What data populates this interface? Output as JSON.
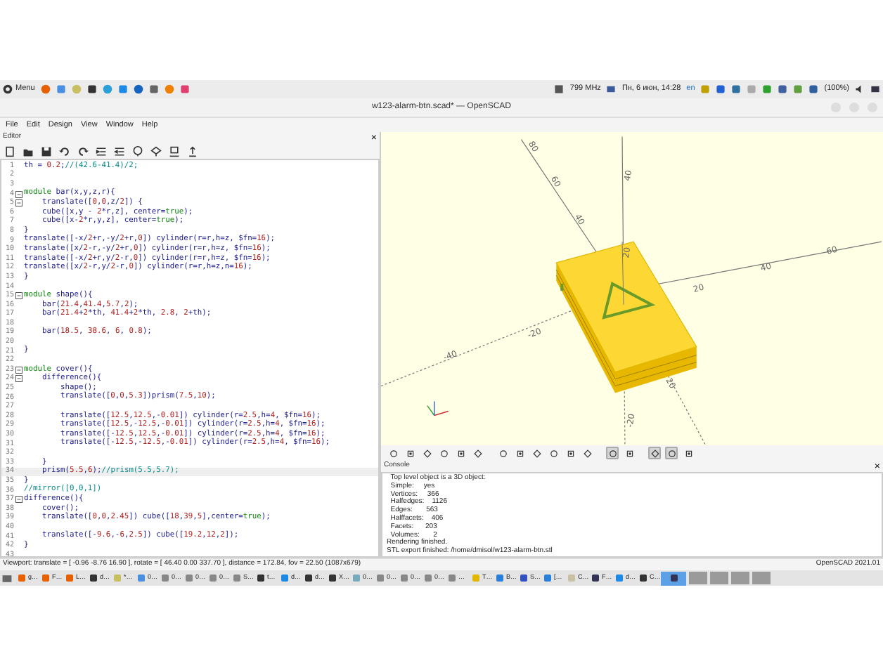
{
  "top_panel": {
    "menu_label": "Menu",
    "cpu": "799 MHz",
    "clock": "Пн, 6 июн, 14:28",
    "keyboard": "en",
    "battery": "(100%)"
  },
  "window": {
    "title": "w123-alarm-btn.scad* — OpenSCAD"
  },
  "menu": [
    "File",
    "Edit",
    "Design",
    "View",
    "Window",
    "Help"
  ],
  "editor": {
    "title": "Editor",
    "close": "×",
    "lines": [
      {
        "number": "1",
        "fold": false,
        "current": false,
        "tokens": [
          {
            "kind": "plain",
            "text": "th = "
          },
          {
            "kind": "number",
            "text": "0.2"
          },
          {
            "kind": "plain",
            "text": ";"
          },
          {
            "kind": "comment",
            "text": "//(42.6-41.4)/2;"
          }
        ]
      },
      {
        "number": "2",
        "fold": false,
        "current": false
      },
      {
        "number": "3",
        "fold": false,
        "current": false
      },
      {
        "number": "4",
        "fold": true,
        "current": false,
        "tokens": [
          {
            "kind": "keyword",
            "text": "module"
          },
          {
            "kind": "plain",
            "text": " bar(x,y,z,r){"
          }
        ]
      },
      {
        "number": "5",
        "fold": true,
        "current": false,
        "tokens": [
          {
            "kind": "plain",
            "text": "    translate(["
          },
          {
            "kind": "number",
            "text": "0"
          },
          {
            "kind": "plain",
            "text": ","
          },
          {
            "kind": "number",
            "text": "0"
          },
          {
            "kind": "plain",
            "text": ",z/"
          },
          {
            "kind": "number",
            "text": "2"
          },
          {
            "kind": "plain",
            "text": "]) {"
          }
        ]
      },
      {
        "number": "6",
        "fold": false,
        "current": false,
        "tokens": [
          {
            "kind": "plain",
            "text": "    cube([x,y - "
          },
          {
            "kind": "number",
            "text": "2"
          },
          {
            "kind": "plain",
            "text": "*r,z], center="
          },
          {
            "kind": "keyword",
            "text": "true"
          },
          {
            "kind": "plain",
            "text": ");"
          }
        ]
      },
      {
        "number": "7",
        "fold": false,
        "current": false,
        "tokens": [
          {
            "kind": "plain",
            "text": "    cube([x-"
          },
          {
            "kind": "number",
            "text": "2"
          },
          {
            "kind": "plain",
            "text": "*r,y,z], center="
          },
          {
            "kind": "keyword",
            "text": "true"
          },
          {
            "kind": "plain",
            "text": ");"
          }
        ]
      },
      {
        "number": "8",
        "fold": false,
        "current": false,
        "tokens": [
          {
            "kind": "plain",
            "text": "}"
          }
        ]
      },
      {
        "number": "9",
        "fold": false,
        "current": false,
        "tokens": [
          {
            "kind": "plain",
            "text": "translate([-x/"
          },
          {
            "kind": "number",
            "text": "2"
          },
          {
            "kind": "plain",
            "text": "+r,-y/"
          },
          {
            "kind": "number",
            "text": "2"
          },
          {
            "kind": "plain",
            "text": "+r,"
          },
          {
            "kind": "number",
            "text": "0"
          },
          {
            "kind": "plain",
            "text": "]) cylinder(r=r,h=z, $fn="
          },
          {
            "kind": "number",
            "text": "16"
          },
          {
            "kind": "plain",
            "text": ");"
          }
        ]
      },
      {
        "number": "10",
        "fold": false,
        "current": false,
        "tokens": [
          {
            "kind": "plain",
            "text": "translate([x/"
          },
          {
            "kind": "number",
            "text": "2"
          },
          {
            "kind": "plain",
            "text": "-r,-y/"
          },
          {
            "kind": "number",
            "text": "2"
          },
          {
            "kind": "plain",
            "text": "+r,"
          },
          {
            "kind": "number",
            "text": "0"
          },
          {
            "kind": "plain",
            "text": "]) cylinder(r=r,h=z, $fn="
          },
          {
            "kind": "number",
            "text": "16"
          },
          {
            "kind": "plain",
            "text": ");"
          }
        ]
      },
      {
        "number": "11",
        "fold": false,
        "current": false,
        "tokens": [
          {
            "kind": "plain",
            "text": "translate([-x/"
          },
          {
            "kind": "number",
            "text": "2"
          },
          {
            "kind": "plain",
            "text": "+r,y/"
          },
          {
            "kind": "number",
            "text": "2"
          },
          {
            "kind": "plain",
            "text": "-r,"
          },
          {
            "kind": "number",
            "text": "0"
          },
          {
            "kind": "plain",
            "text": "]) cylinder(r=r,h=z, $fn="
          },
          {
            "kind": "number",
            "text": "16"
          },
          {
            "kind": "plain",
            "text": ");"
          }
        ]
      },
      {
        "number": "12",
        "fold": false,
        "current": false,
        "tokens": [
          {
            "kind": "plain",
            "text": "translate([x/"
          },
          {
            "kind": "number",
            "text": "2"
          },
          {
            "kind": "plain",
            "text": "-r,y/"
          },
          {
            "kind": "number",
            "text": "2"
          },
          {
            "kind": "plain",
            "text": "-r,"
          },
          {
            "kind": "number",
            "text": "0"
          },
          {
            "kind": "plain",
            "text": "]) cylinder(r=r,h=z,n="
          },
          {
            "kind": "number",
            "text": "16"
          },
          {
            "kind": "plain",
            "text": ");"
          }
        ]
      },
      {
        "number": "13",
        "fold": false,
        "current": false,
        "tokens": [
          {
            "kind": "plain",
            "text": "}"
          }
        ]
      },
      {
        "number": "14",
        "fold": false,
        "current": false
      },
      {
        "number": "15",
        "fold": true,
        "current": false,
        "tokens": [
          {
            "kind": "keyword",
            "text": "module"
          },
          {
            "kind": "plain",
            "text": " shape(){"
          }
        ]
      },
      {
        "number": "16",
        "fold": false,
        "current": false,
        "tokens": [
          {
            "kind": "plain",
            "text": "    bar("
          },
          {
            "kind": "number",
            "text": "21.4"
          },
          {
            "kind": "plain",
            "text": ","
          },
          {
            "kind": "number",
            "text": "41.4"
          },
          {
            "kind": "plain",
            "text": ","
          },
          {
            "kind": "number",
            "text": "5.7"
          },
          {
            "kind": "plain",
            "text": ","
          },
          {
            "kind": "number",
            "text": "2"
          },
          {
            "kind": "plain",
            "text": ");"
          }
        ]
      },
      {
        "number": "17",
        "fold": false,
        "current": false,
        "tokens": [
          {
            "kind": "plain",
            "text": "    bar("
          },
          {
            "kind": "number",
            "text": "21.4"
          },
          {
            "kind": "plain",
            "text": "+"
          },
          {
            "kind": "number",
            "text": "2"
          },
          {
            "kind": "plain",
            "text": "*th, "
          },
          {
            "kind": "number",
            "text": "41.4"
          },
          {
            "kind": "plain",
            "text": "+"
          },
          {
            "kind": "number",
            "text": "2"
          },
          {
            "kind": "plain",
            "text": "*th, "
          },
          {
            "kind": "number",
            "text": "2.8"
          },
          {
            "kind": "plain",
            "text": ", "
          },
          {
            "kind": "number",
            "text": "2"
          },
          {
            "kind": "plain",
            "text": "+th);"
          }
        ]
      },
      {
        "number": "18",
        "fold": false,
        "current": false
      },
      {
        "number": "19",
        "fold": false,
        "current": false,
        "tokens": [
          {
            "kind": "plain",
            "text": "    bar("
          },
          {
            "kind": "number",
            "text": "18.5"
          },
          {
            "kind": "plain",
            "text": ", "
          },
          {
            "kind": "number",
            "text": "38.6"
          },
          {
            "kind": "plain",
            "text": ", "
          },
          {
            "kind": "number",
            "text": "6"
          },
          {
            "kind": "plain",
            "text": ", "
          },
          {
            "kind": "number",
            "text": "0.8"
          },
          {
            "kind": "plain",
            "text": ");"
          }
        ]
      },
      {
        "number": "20",
        "fold": false,
        "current": false
      },
      {
        "number": "21",
        "fold": false,
        "current": false,
        "tokens": [
          {
            "kind": "plain",
            "text": "}"
          }
        ]
      },
      {
        "number": "22",
        "fold": false,
        "current": false
      },
      {
        "number": "23",
        "fold": true,
        "current": false,
        "tokens": [
          {
            "kind": "keyword",
            "text": "module"
          },
          {
            "kind": "plain",
            "text": " cover(){"
          }
        ]
      },
      {
        "number": "24",
        "fold": true,
        "current": false,
        "tokens": [
          {
            "kind": "plain",
            "text": "    difference(){"
          }
        ]
      },
      {
        "number": "25",
        "fold": false,
        "current": false,
        "tokens": [
          {
            "kind": "plain",
            "text": "        shape();"
          }
        ]
      },
      {
        "number": "26",
        "fold": false,
        "current": false,
        "tokens": [
          {
            "kind": "plain",
            "text": "        translate(["
          },
          {
            "kind": "number",
            "text": "0"
          },
          {
            "kind": "plain",
            "text": ","
          },
          {
            "kind": "number",
            "text": "0"
          },
          {
            "kind": "plain",
            "text": ","
          },
          {
            "kind": "number",
            "text": "5.3"
          },
          {
            "kind": "plain",
            "text": "])prism("
          },
          {
            "kind": "number",
            "text": "7.5"
          },
          {
            "kind": "plain",
            "text": ","
          },
          {
            "kind": "number",
            "text": "10"
          },
          {
            "kind": "plain",
            "text": ");"
          }
        ]
      },
      {
        "number": "27",
        "fold": false,
        "current": false
      },
      {
        "number": "28",
        "fold": false,
        "current": false,
        "tokens": [
          {
            "kind": "plain",
            "text": "        translate(["
          },
          {
            "kind": "number",
            "text": "12.5"
          },
          {
            "kind": "plain",
            "text": ","
          },
          {
            "kind": "number",
            "text": "12.5"
          },
          {
            "kind": "plain",
            "text": ",-"
          },
          {
            "kind": "number",
            "text": "0.01"
          },
          {
            "kind": "plain",
            "text": "]) cylinder(r="
          },
          {
            "kind": "number",
            "text": "2.5"
          },
          {
            "kind": "plain",
            "text": ",h="
          },
          {
            "kind": "number",
            "text": "4"
          },
          {
            "kind": "plain",
            "text": ", $fn="
          },
          {
            "kind": "number",
            "text": "16"
          },
          {
            "kind": "plain",
            "text": ");"
          }
        ]
      },
      {
        "number": "29",
        "fold": false,
        "current": false,
        "tokens": [
          {
            "kind": "plain",
            "text": "        translate(["
          },
          {
            "kind": "number",
            "text": "12.5"
          },
          {
            "kind": "plain",
            "text": ",-"
          },
          {
            "kind": "number",
            "text": "12.5"
          },
          {
            "kind": "plain",
            "text": ",-"
          },
          {
            "kind": "number",
            "text": "0.01"
          },
          {
            "kind": "plain",
            "text": "]) cylinder(r="
          },
          {
            "kind": "number",
            "text": "2.5"
          },
          {
            "kind": "plain",
            "text": ",h="
          },
          {
            "kind": "number",
            "text": "4"
          },
          {
            "kind": "plain",
            "text": ", $fn="
          },
          {
            "kind": "number",
            "text": "16"
          },
          {
            "kind": "plain",
            "text": ");"
          }
        ]
      },
      {
        "number": "30",
        "fold": false,
        "current": false,
        "tokens": [
          {
            "kind": "plain",
            "text": "        translate([-"
          },
          {
            "kind": "number",
            "text": "12.5"
          },
          {
            "kind": "plain",
            "text": ","
          },
          {
            "kind": "number",
            "text": "12.5"
          },
          {
            "kind": "plain",
            "text": ",-"
          },
          {
            "kind": "number",
            "text": "0.01"
          },
          {
            "kind": "plain",
            "text": "]) cylinder(r="
          },
          {
            "kind": "number",
            "text": "2.5"
          },
          {
            "kind": "plain",
            "text": ",h="
          },
          {
            "kind": "number",
            "text": "4"
          },
          {
            "kind": "plain",
            "text": ", $fn="
          },
          {
            "kind": "number",
            "text": "16"
          },
          {
            "kind": "plain",
            "text": ");"
          }
        ]
      },
      {
        "number": "31",
        "fold": false,
        "current": false,
        "tokens": [
          {
            "kind": "plain",
            "text": "        translate([-"
          },
          {
            "kind": "number",
            "text": "12.5"
          },
          {
            "kind": "plain",
            "text": ",-"
          },
          {
            "kind": "number",
            "text": "12.5"
          },
          {
            "kind": "plain",
            "text": ",-"
          },
          {
            "kind": "number",
            "text": "0.01"
          },
          {
            "kind": "plain",
            "text": "]) cylinder(r="
          },
          {
            "kind": "number",
            "text": "2.5"
          },
          {
            "kind": "plain",
            "text": ",h="
          },
          {
            "kind": "number",
            "text": "4"
          },
          {
            "kind": "plain",
            "text": ", $fn="
          },
          {
            "kind": "number",
            "text": "16"
          },
          {
            "kind": "plain",
            "text": ");"
          }
        ]
      },
      {
        "number": "32",
        "fold": false,
        "current": false
      },
      {
        "number": "33",
        "fold": false,
        "current": false,
        "tokens": [
          {
            "kind": "plain",
            "text": "    }"
          }
        ]
      },
      {
        "number": "34",
        "fold": false,
        "current": true,
        "tokens": [
          {
            "kind": "plain",
            "text": "    prism("
          },
          {
            "kind": "number",
            "text": "5.5"
          },
          {
            "kind": "plain",
            "text": ","
          },
          {
            "kind": "number",
            "text": "6"
          },
          {
            "kind": "plain",
            "text": ");"
          },
          {
            "kind": "comment",
            "text": "//prism(5.5,5.7);"
          }
        ]
      },
      {
        "number": "35",
        "fold": false,
        "current": false,
        "tokens": [
          {
            "kind": "plain",
            "text": "}"
          }
        ]
      },
      {
        "number": "36",
        "fold": false,
        "current": false,
        "tokens": [
          {
            "kind": "comment",
            "text": "//mirror([0,0,1])"
          }
        ]
      },
      {
        "number": "37",
        "fold": true,
        "current": false,
        "tokens": [
          {
            "kind": "plain",
            "text": "difference(){"
          }
        ]
      },
      {
        "number": "38",
        "fold": false,
        "current": false,
        "tokens": [
          {
            "kind": "plain",
            "text": "    cover();"
          }
        ]
      },
      {
        "number": "39",
        "fold": false,
        "current": false,
        "tokens": [
          {
            "kind": "plain",
            "text": "    translate(["
          },
          {
            "kind": "number",
            "text": "0"
          },
          {
            "kind": "plain",
            "text": ","
          },
          {
            "kind": "number",
            "text": "0"
          },
          {
            "kind": "plain",
            "text": ","
          },
          {
            "kind": "number",
            "text": "2.45"
          },
          {
            "kind": "plain",
            "text": "]) cube(["
          },
          {
            "kind": "number",
            "text": "18"
          },
          {
            "kind": "plain",
            "text": ","
          },
          {
            "kind": "number",
            "text": "39"
          },
          {
            "kind": "plain",
            "text": ","
          },
          {
            "kind": "number",
            "text": "5"
          },
          {
            "kind": "plain",
            "text": "],center="
          },
          {
            "kind": "keyword",
            "text": "true"
          },
          {
            "kind": "plain",
            "text": ");"
          }
        ]
      },
      {
        "number": "40",
        "fold": false,
        "current": false
      },
      {
        "number": "41",
        "fold": false,
        "current": false,
        "tokens": [
          {
            "kind": "plain",
            "text": "    translate([-"
          },
          {
            "kind": "number",
            "text": "9.6"
          },
          {
            "kind": "plain",
            "text": ",-"
          },
          {
            "kind": "number",
            "text": "6"
          },
          {
            "kind": "plain",
            "text": ","
          },
          {
            "kind": "number",
            "text": "2.5"
          },
          {
            "kind": "plain",
            "text": "]) cube(["
          },
          {
            "kind": "number",
            "text": "19.2"
          },
          {
            "kind": "plain",
            "text": ","
          },
          {
            "kind": "number",
            "text": "12"
          },
          {
            "kind": "plain",
            "text": ","
          },
          {
            "kind": "number",
            "text": "2"
          },
          {
            "kind": "plain",
            "text": "]);"
          }
        ]
      },
      {
        "number": "42",
        "fold": false,
        "current": false,
        "tokens": [
          {
            "kind": "plain",
            "text": "}"
          }
        ]
      },
      {
        "number": "43",
        "fold": false,
        "current": false
      }
    ]
  },
  "viewport": {
    "axis_labels": [
      "80",
      "60",
      "40",
      "40",
      "20",
      "20",
      "40",
      "60",
      "-20",
      "-40",
      "20",
      "-20"
    ]
  },
  "view_toolbar": [
    {
      "selected": false
    },
    {
      "selected": false
    },
    {
      "selected": false
    },
    {
      "selected": false
    },
    {
      "selected": false
    },
    {
      "selected": false
    },
    {
      "selected": false
    },
    {
      "selected": false
    },
    {
      "selected": false
    },
    {
      "selected": false
    },
    {
      "selected": false
    },
    {
      "selected": false
    },
    {
      "selected": true
    },
    {
      "selected": false
    },
    {
      "selected": true
    },
    {
      "selected": true
    },
    {
      "selected": false
    }
  ],
  "console": {
    "title": "Console",
    "close": "×",
    "lines": [
      "  Top level object is a 3D object:",
      "  Simple:     yes",
      "  Vertices:     366",
      "  Halfedges:    1126",
      "  Edges:       563",
      "  Halffacets:    406",
      "  Facets:      203",
      "  Volumes:       2",
      "Rendering finished.",
      "STL export finished: /home/dmisol/w123-alarm-btn.stl"
    ]
  },
  "status_bar": {
    "viewport": "Viewport: translate = [ -0.96 -8.76 16.90 ], rotate = [ 46.40 0.00 337.70 ], distance = 172.84, fov = 22.50 (1087x679)",
    "version": "OpenSCAD 2021.01"
  },
  "taskbar": [
    {
      "label": "g…",
      "selected": false
    },
    {
      "label": "F…",
      "selected": false
    },
    {
      "label": "L…",
      "selected": false
    },
    {
      "label": "d…",
      "selected": false
    },
    {
      "label": "*…",
      "selected": false
    },
    {
      "label": "0…",
      "selected": false
    },
    {
      "label": "0…",
      "selected": false
    },
    {
      "label": "0…",
      "selected": false
    },
    {
      "label": "0…",
      "selected": false
    },
    {
      "label": "S…",
      "selected": false
    },
    {
      "label": "t…",
      "selected": false
    },
    {
      "label": "d…",
      "selected": false
    },
    {
      "label": "d…",
      "selected": false
    },
    {
      "label": "X…",
      "selected": false
    },
    {
      "label": "0…",
      "selected": false
    },
    {
      "label": "0…",
      "selected": false
    },
    {
      "label": "0…",
      "selected": false
    },
    {
      "label": "0…",
      "selected": false
    },
    {
      "label": "…",
      "selected": false
    },
    {
      "label": "T…",
      "selected": false
    },
    {
      "label": "B…",
      "selected": false
    },
    {
      "label": "S…",
      "selected": false
    },
    {
      "label": "[…",
      "selected": false
    },
    {
      "label": "C…",
      "selected": false
    },
    {
      "label": "F…",
      "selected": false
    },
    {
      "label": "d…",
      "selected": false
    },
    {
      "label": "C…",
      "selected": false
    },
    {
      "selected": true
    }
  ]
}
